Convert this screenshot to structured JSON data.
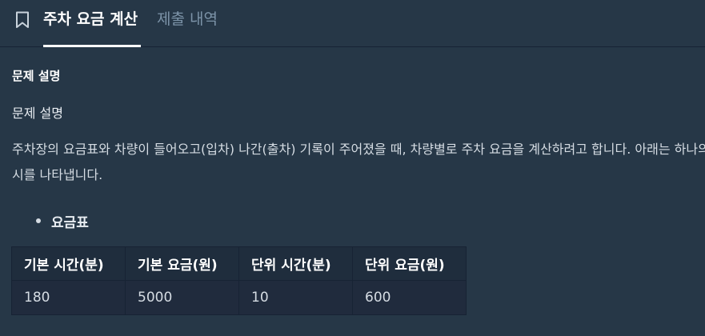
{
  "header": {
    "icon": "bookmark-icon",
    "tabs": [
      {
        "label": "주차 요금 계산",
        "active": true
      },
      {
        "label": "제출 내역",
        "active": false
      }
    ]
  },
  "problem": {
    "section_title": "문제 설명",
    "subtitle": "문제 설명",
    "paragraph": "주차장의 요금표와 차량이 들어오고(입차) 나간(출차) 기록이 주어졌을 때, 차량별로 주차 요금을 계산하려고 합니다. 아래는 하나의 예시를 나타냅니다.",
    "bullet": "요금표",
    "fee_table": {
      "headers": [
        "기본 시간(분)",
        "기본 요금(원)",
        "단위 시간(분)",
        "단위 요금(원)"
      ],
      "row": [
        "180",
        "5000",
        "10",
        "600"
      ]
    }
  },
  "colors": {
    "background": "#263747",
    "table_header_bg": "#1f2d3d",
    "table_cell_bg": "#202b3d",
    "active_tab": "#ffffff",
    "inactive_tab": "#7c93a8"
  }
}
